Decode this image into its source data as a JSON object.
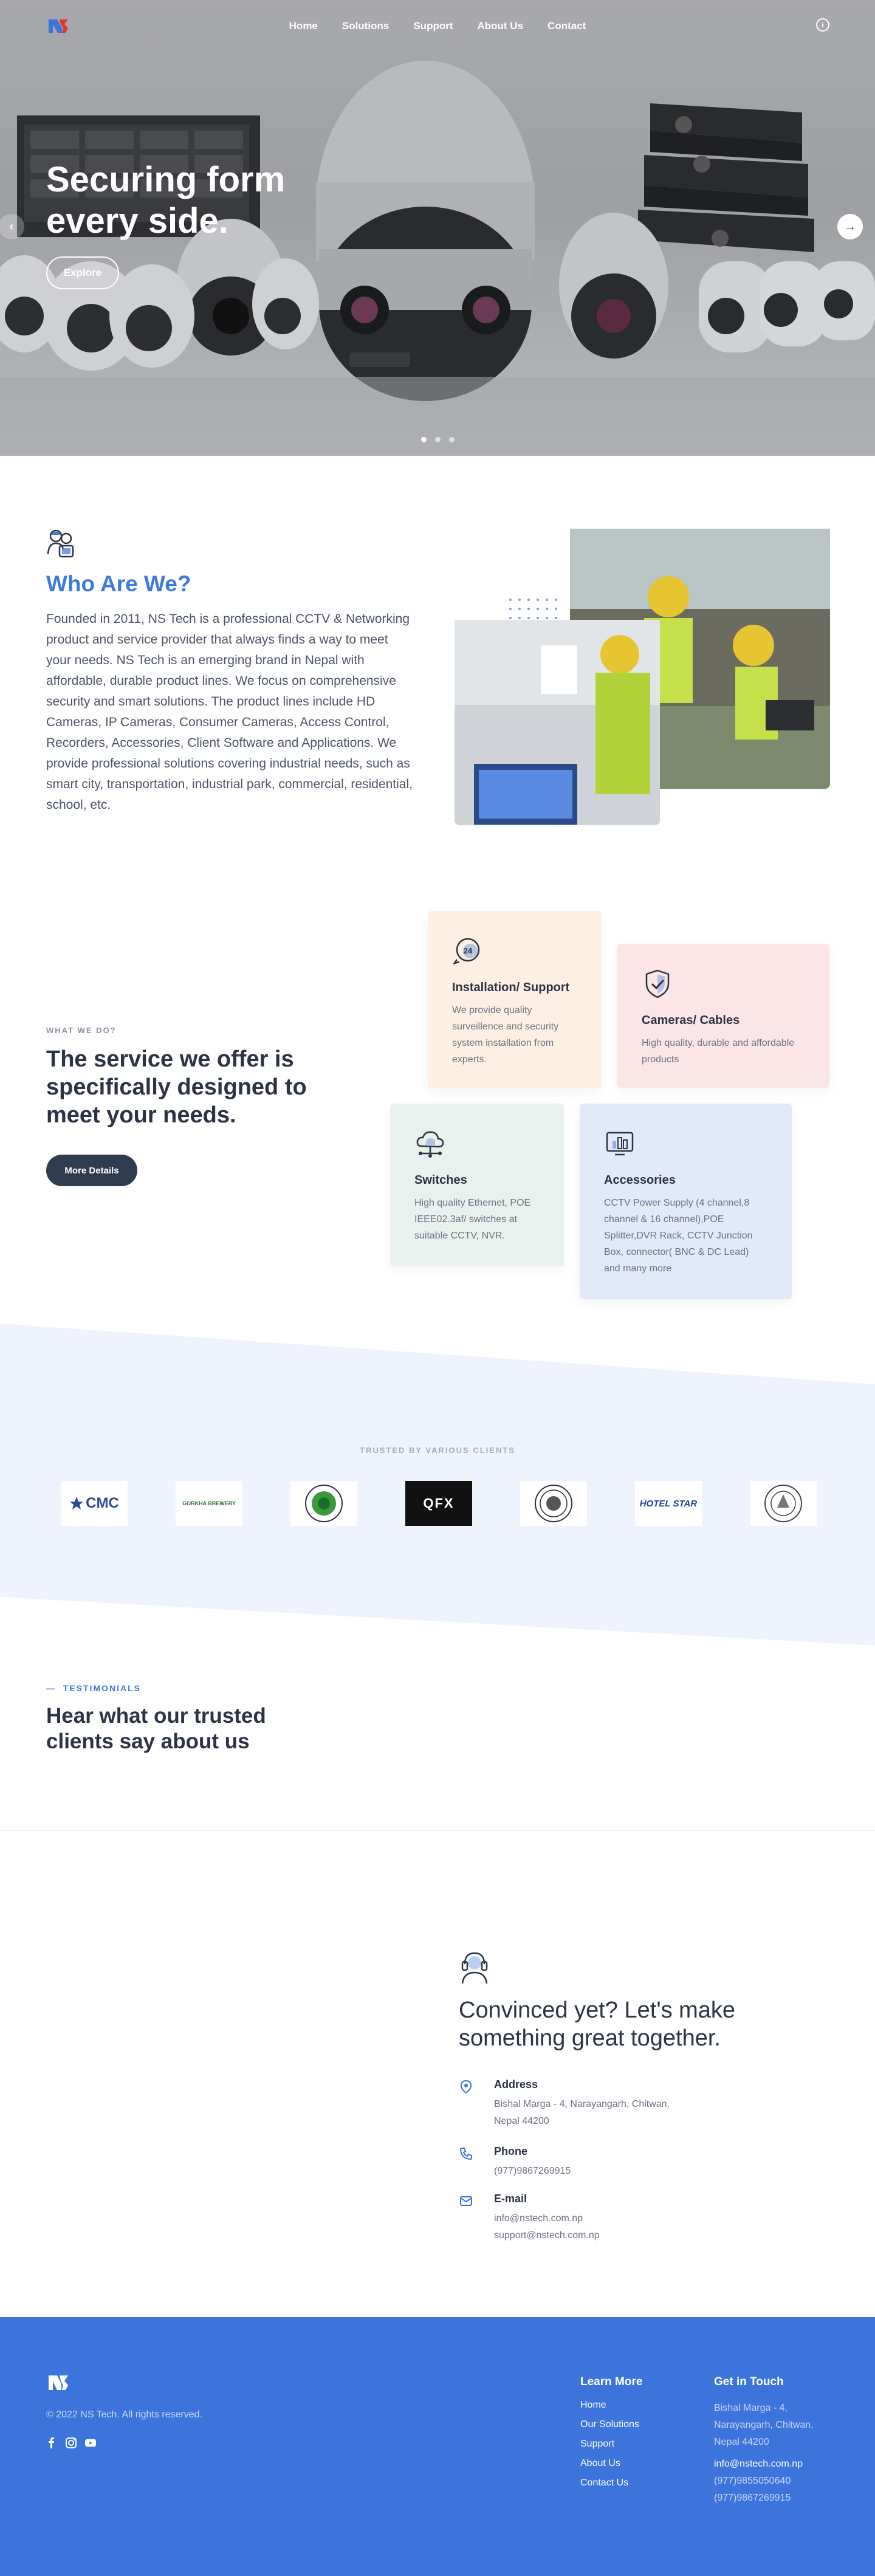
{
  "brand": {
    "logo": "ns-logo",
    "primary": "#3d74dc",
    "dark": "#2f3b4e"
  },
  "nav": {
    "items": [
      "Home",
      "Solutions",
      "Support",
      "About Us",
      "Contact"
    ],
    "info_icon": "info-icon"
  },
  "hero": {
    "title": "Securing form every side.",
    "cta": "Explore",
    "slides_total": 3,
    "slide_active": 1
  },
  "about": {
    "icon": "team-icon",
    "title": "Who Are We?",
    "text": "Founded in 2011, NS Tech is a professional CCTV & Networking product and service provider that always finds a way to meet your needs. NS Tech is an emerging brand in Nepal with affordable, durable product lines. We focus on comprehensive security and smart solutions. The product lines include HD Cameras, IP Cameras, Consumer Cameras, Access Control, Recorders, Accessories, Client Software and Applications. We provide professional solutions covering industrial needs, such as smart city, transportation, industrial park, commercial, residential, school, etc."
  },
  "services": {
    "kicker": "WHAT WE DO?",
    "title": "The service we offer is specifically designed to meet your needs.",
    "cta": "More Details",
    "cards": [
      {
        "icon": "support-24-icon",
        "title": "Installation/ Support",
        "text": "We provide quality surveillence and security system installation from experts.",
        "bg": "#fdf0e3"
      },
      {
        "icon": "shield-check-icon",
        "title": "Cameras/ Cables",
        "text": "High quality, durable and affordable products",
        "bg": "#fbe5e6"
      },
      {
        "icon": "network-cloud-icon",
        "title": "Switches",
        "text": "High quality Ethernet, POE IEEE02.3af/ switches at suitable CCTV, NVR.",
        "bg": "#e8f1ed"
      },
      {
        "icon": "monitor-chart-icon",
        "title": "Accessories",
        "text": "CCTV Power Supply (4 channel,8 channel & 16 channel),POE Splitter,DVR Rack, CCTV Junction Box, connector( BNC & DC Lead) and many more",
        "bg": "#e2e9f8"
      }
    ]
  },
  "clients": {
    "label": "TRUSTED BY VARIOUS CLIENTS",
    "logos": [
      "CMC",
      "GORKHA BREWERY",
      "",
      "QFX",
      "",
      "HOTEL STAR",
      ""
    ]
  },
  "testimonials": {
    "kicker": "TESTIMONIALS",
    "title": "Hear what our trusted clients say about us"
  },
  "contact": {
    "icon": "headset-icon",
    "title": "Convinced yet? Let's make something great together.",
    "address_label": "Address",
    "address": "Bishal Marga - 4, Narayangarh, Chitwan, Nepal 44200",
    "phone_label": "Phone",
    "phone": "(977)9867269915",
    "email_label": "E-mail",
    "email1": "info@nstech.com.np",
    "email2": "support@nstech.com.np"
  },
  "footer": {
    "copyright": "© 2022 NS Tech. All rights reserved.",
    "social": [
      "facebook-icon",
      "instagram-icon",
      "youtube-icon"
    ],
    "learn_title": "Learn More",
    "links": [
      "Home",
      "Our Solutions",
      "Support",
      "About Us",
      "Contact Us"
    ],
    "touch_title": "Get in Touch",
    "address": "Bishal Marga - 4, Narayangarh, Chitwan, Nepal 44200",
    "email": "info@nstech.com.np",
    "phone1": "(977)9855050640",
    "phone2": "(977)9867269915"
  }
}
